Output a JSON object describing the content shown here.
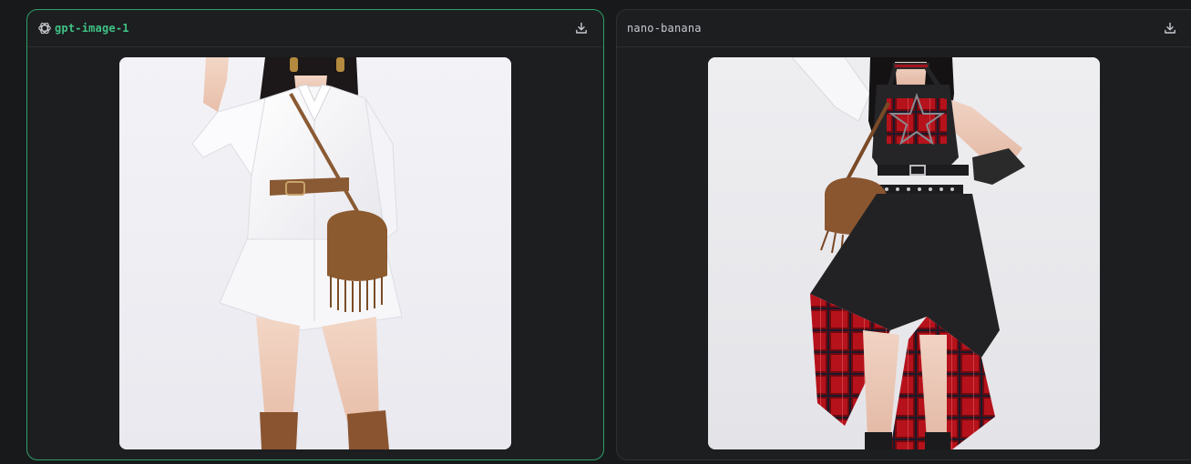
{
  "panels": [
    {
      "model_name": "gpt-image-1",
      "selected": true,
      "logo_icon": "openai-logo-icon",
      "download_icon": "download-icon",
      "image_subject": "white-shirt-dress-outfit"
    },
    {
      "model_name": "nano-banana",
      "selected": false,
      "download_icon": "download-icon",
      "image_subject": "gothic-plaid-dress-outfit"
    }
  ],
  "colors": {
    "background": "#18191b",
    "panel": "#1d1e20",
    "accent": "#3fc285",
    "selected_border": "#2e9f68",
    "muted_text": "#c7cad0"
  }
}
